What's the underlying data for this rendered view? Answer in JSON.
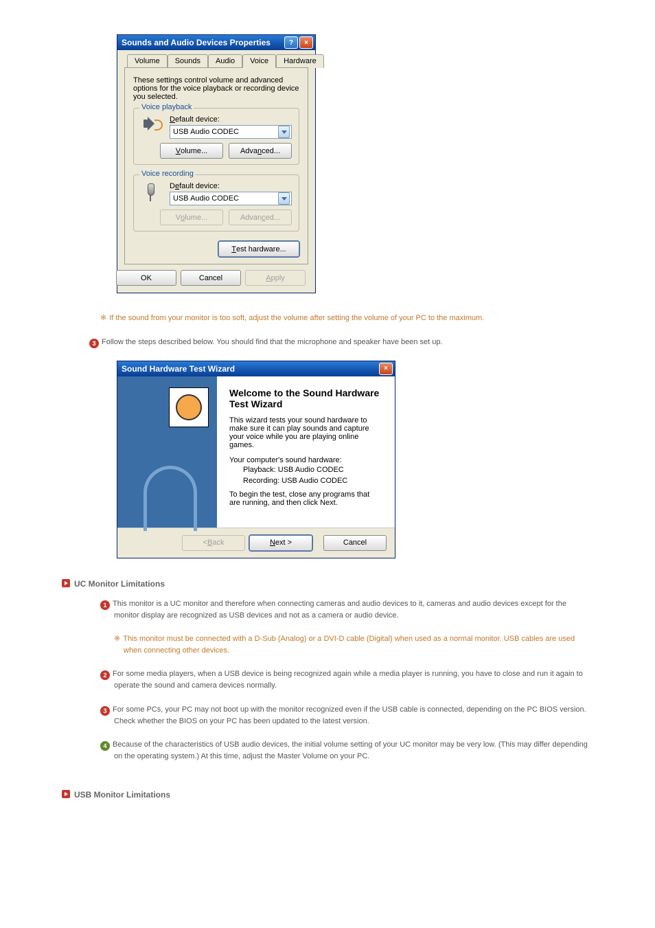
{
  "dialog": {
    "title": "Sounds and Audio Devices Properties",
    "help": "?",
    "close": "×",
    "tabs": {
      "volume": "Volume",
      "sounds": "Sounds",
      "audio": "Audio",
      "voice": "Voice",
      "hardware": "Hardware"
    },
    "desc": "These settings control volume and advanced options for the voice playback or recording device you selected.",
    "playback": {
      "legend": "Voice playback",
      "label": "Default device:",
      "value": "USB Audio CODEC",
      "volume_btn": "Volume...",
      "advanced_btn": "Advanced..."
    },
    "recording": {
      "legend": "Voice recording",
      "label": "Default device:",
      "value": "USB Audio CODEC",
      "volume_btn": "Volume...",
      "advanced_btn": "Advanced..."
    },
    "test_btn": "Test hardware...",
    "ok": "OK",
    "cancel": "Cancel",
    "apply": "Apply"
  },
  "notes": {
    "soft_sound": "If the sound from your monitor is too soft, adjust the volume after setting the volume of your PC to the maximum.",
    "step3": "Follow the steps described below. You should find that the microphone and speaker have been set up.",
    "asterisk": "※"
  },
  "wizard": {
    "title": "Sound Hardware Test Wizard",
    "close": "×",
    "heading": "Welcome to the Sound Hardware Test Wizard",
    "intro": "This wizard tests your sound hardware to make sure it can play sounds and capture your voice while you are playing online games.",
    "hw_label": "Your computer's sound hardware:",
    "playback": "Playback:  USB Audio CODEC",
    "recording": "Recording:  USB Audio CODEC",
    "begin": "To begin the test, close any programs that are running, and then click Next.",
    "back": "< Back",
    "next": "Next >",
    "cancel": "Cancel"
  },
  "sections": {
    "uc_header": "UC Monitor Limitations",
    "usb_header": "USB Monitor Limitations",
    "uc1": "This monitor is a UC monitor and therefore when connecting cameras and audio devices to it, cameras and audio devices except for the monitor display are recognized as USB devices and not as a camera or audio device.",
    "uc_note": "This monitor must be connected with a D-Sub (Analog) or a DVI-D cable (Digital) when used as a normal monitor. USB cables are used when connecting other devices.",
    "uc2": "For some media players, when a USB device is being recognized again while a media player is running, you have to close and run it again to operate the sound and camera devices normally.",
    "uc3a": "For some PCs, your PC may not boot up with the monitor recognized even if the USB cable is connected, depending on the PC BIOS version.",
    "uc3b": "Check whether the BIOS on your PC has been updated to the latest version.",
    "uc4": "Because of the characteristics of USB audio devices, the initial volume setting of your UC monitor may be very low. (This may differ depending on the operating system.) At this time, adjust the Master Volume on your PC."
  },
  "nums": {
    "n1": "1",
    "n2": "2",
    "n3": "3",
    "n4": "4"
  }
}
